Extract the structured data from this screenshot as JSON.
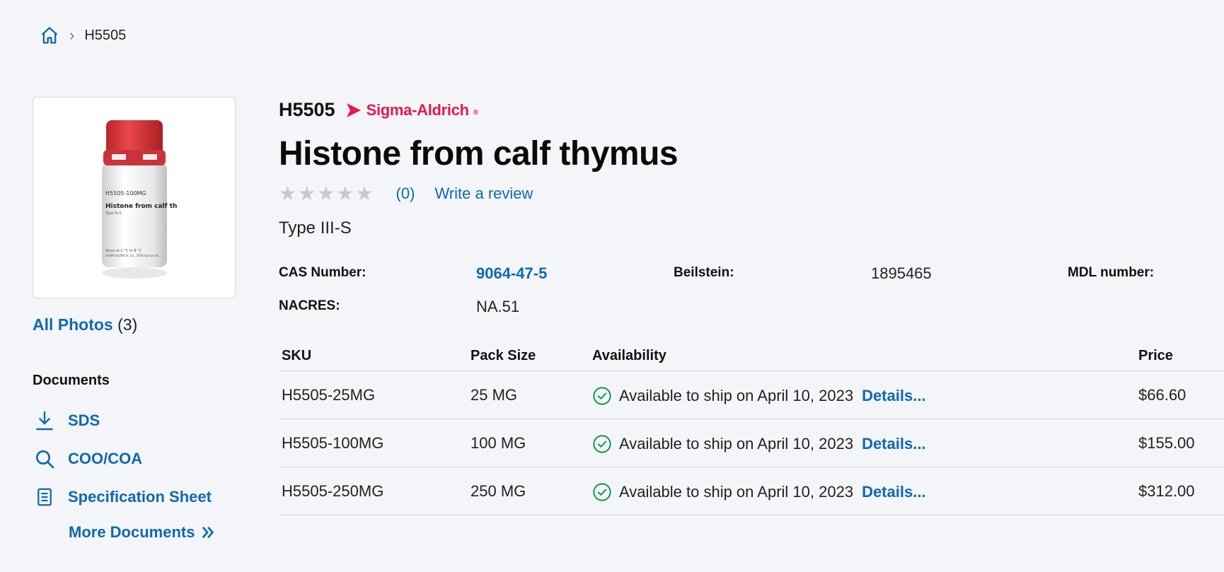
{
  "breadcrumb": {
    "current": "H5505"
  },
  "product": {
    "sku": "H5505",
    "brand": "Sigma-Aldrich",
    "brand_mark": "®",
    "title": "Histone from calf thymus",
    "rating": 0,
    "review_count": "(0)",
    "write_review": "Write a review",
    "subtitle": "Type III-S",
    "bottle_label_code": "H5505-100MG",
    "bottle_label_name": "Histone from calf th",
    "bottle_label_type": "Type III-S",
    "bottle_label_storage": "Store at 2 °C to 8 °C",
    "bottle_label_maker": "SIGMA-ALDRICH, Co., 3050 Spruce St."
  },
  "properties": {
    "cas_label": "CAS Number:",
    "cas_value": "9064-47-5",
    "beilstein_label": "Beilstein:",
    "beilstein_value": "1895465",
    "mdl_label": "MDL number:",
    "nacres_label": "NACRES:",
    "nacres_value": "NA.51"
  },
  "photos": {
    "label": "All Photos",
    "count": "(3)"
  },
  "documents": {
    "title": "Documents",
    "items": [
      {
        "label": "SDS",
        "icon": "download-icon"
      },
      {
        "label": "COO/COA",
        "icon": "search-icon"
      },
      {
        "label": "Specification Sheet",
        "icon": "document-icon"
      }
    ],
    "more": "More Documents"
  },
  "table": {
    "headers": {
      "sku": "SKU",
      "pack": "Pack Size",
      "availability": "Availability",
      "price": "Price"
    },
    "rows": [
      {
        "sku": "H5505-25MG",
        "pack": "25 MG",
        "availability": "Available to ship on April 10, 2023",
        "details": "Details...",
        "price": "$66.60"
      },
      {
        "sku": "H5505-100MG",
        "pack": "100 MG",
        "availability": "Available to ship on April 10, 2023",
        "details": "Details...",
        "price": "$155.00"
      },
      {
        "sku": "H5505-250MG",
        "pack": "250 MG",
        "availability": "Available to ship on April 10, 2023",
        "details": "Details...",
        "price": "$312.00"
      }
    ]
  },
  "colors": {
    "link": "#0f69af",
    "brand": "#e6194b",
    "success": "#1a9e54",
    "background": "#f4f5f8"
  }
}
